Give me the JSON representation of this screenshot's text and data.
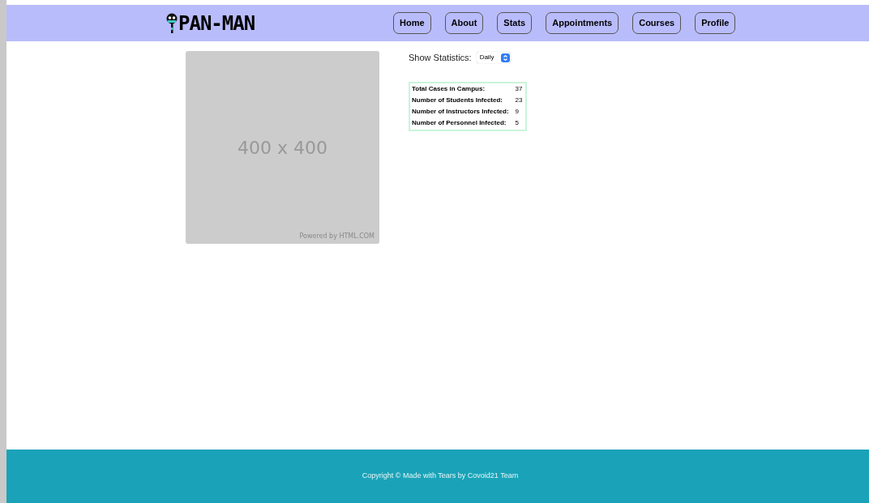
{
  "header": {
    "logo": "PAN-MAN",
    "nav": [
      {
        "label": "Home"
      },
      {
        "label": "About"
      },
      {
        "label": "Stats"
      },
      {
        "label": "Appointments"
      },
      {
        "label": "Courses"
      },
      {
        "label": "Profile"
      }
    ]
  },
  "placeholder_image": {
    "label": "400 x 400",
    "credit": "Powered by HTML.COM"
  },
  "statistics": {
    "label": "Show Statistics:",
    "period": "Daily",
    "rows": [
      {
        "name": "Total Cases in Campus:",
        "value": "37"
      },
      {
        "name": "Number of Students Infected:",
        "value": "23"
      },
      {
        "name": "Number of Instructors Infected:",
        "value": "9"
      },
      {
        "name": "Number of Personnel Infected:",
        "value": "5"
      }
    ]
  },
  "footer": {
    "text": "Copyright © Made with Tears by Covoid21 Team"
  }
}
